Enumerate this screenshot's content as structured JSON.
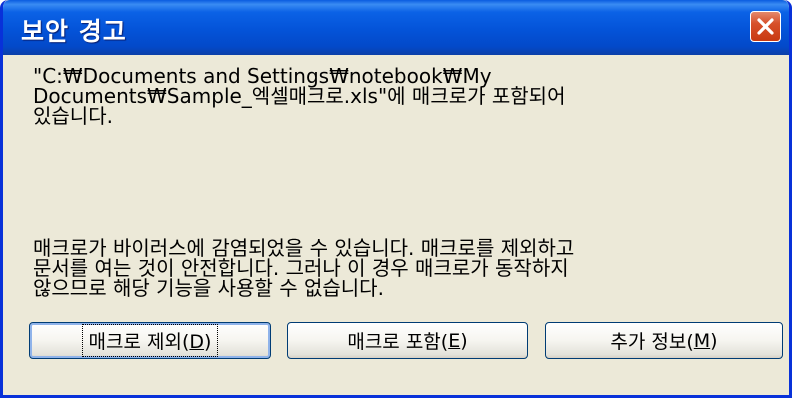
{
  "window": {
    "title": "보안 경고",
    "close_icon": "close-icon"
  },
  "message": {
    "lines": [
      "\"C:₩Documents and Settings₩notebook₩My",
      "Documents₩Sample_엑셀매크로.xls\"에 매크로가 포함되어",
      "있습니다."
    ]
  },
  "warning": {
    "lines": [
      "매크로가 바이러스에 감염되었을 수 있습니다. 매크로를 제외하고",
      "문서를 여는 것이 안전합니다. 그러나 이 경우 매크로가 동작하지",
      "않으므로 해당 기능을 사용할 수 없습니다."
    ]
  },
  "buttons": {
    "disable": {
      "label": "매크로 제외(",
      "mnemonic": "D",
      "suffix": ")"
    },
    "enable": {
      "label": "매크로 포함(",
      "mnemonic": "E",
      "suffix": ")"
    },
    "more_info": {
      "label": "추가 정보(",
      "mnemonic": "M",
      "suffix": ")"
    }
  },
  "colors": {
    "titlebar": "#0453d8",
    "window_bg": "#ece9d8",
    "close_button": "#d7502a"
  }
}
